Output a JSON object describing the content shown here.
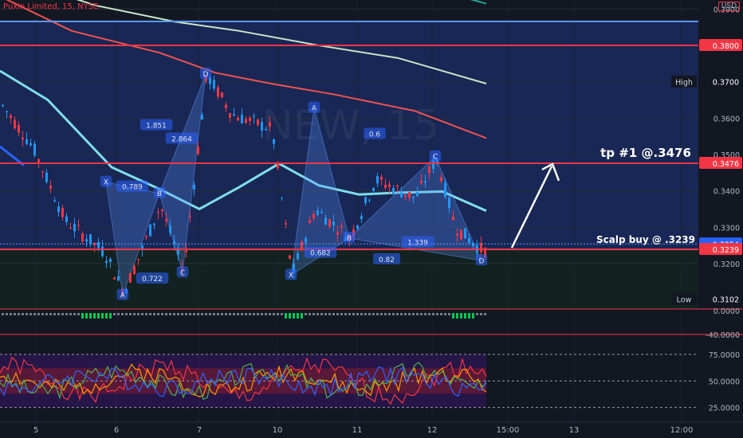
{
  "header": {
    "title": "Puxin Limited, 15, NYSE",
    "currency": "USD"
  },
  "chart_data": {
    "type": "candlestick",
    "x_ticks": [
      "5",
      "6",
      "7",
      "10",
      "11",
      "12",
      "15:00",
      "13",
      "12:00"
    ],
    "price_axis": {
      "ylim": [
        0.3075,
        0.3925
      ],
      "ticks": [
        "0.3900",
        "0.3800",
        "0.3700",
        "0.3600",
        "0.3500",
        "0.3400",
        "0.3300",
        "0.3200"
      ],
      "markers": [
        {
          "label": "0.3800",
          "value": 0.38,
          "color": "#f23645"
        },
        {
          "label": "0.3476",
          "value": 0.3476,
          "color": "#f23645"
        },
        {
          "label": "0.3254",
          "value": 0.3254,
          "color": "#2962ff"
        },
        {
          "label": "0.3239",
          "value": 0.3239,
          "color": "#f23645"
        },
        {
          "label": "0.3700",
          "value": 0.37,
          "color": "#131722",
          "tag": "High"
        },
        {
          "label": "0.3102",
          "value": 0.3102,
          "color": "#131722",
          "tag": "Low"
        }
      ]
    },
    "hlines": [
      {
        "value": 0.3866,
        "color": "#5b9cf6"
      },
      {
        "value": 0.38,
        "color": "#f23645"
      },
      {
        "value": 0.3476,
        "color": "#f23645"
      },
      {
        "value": 0.3239,
        "color": "#f23645"
      }
    ],
    "annotations": {
      "tp": "tp #1 @.3476",
      "scalp": "Scalp buy @ .3239",
      "symbol_watermark": "NEW, 15",
      "pattern_points": [
        {
          "t": "D",
          "x": 258,
          "v": 0.3721
        },
        {
          "t": "X",
          "x": 133,
          "v": 0.3424
        },
        {
          "t": "A",
          "x": 154,
          "v": 0.3113
        },
        {
          "t": "B",
          "x": 200,
          "v": 0.3393
        },
        {
          "t": "C",
          "x": 229,
          "v": 0.3175
        },
        {
          "t": "A",
          "x": 394,
          "v": 0.3628
        },
        {
          "t": "X",
          "x": 365,
          "v": 0.3168
        },
        {
          "t": "B",
          "x": 438,
          "v": 0.327
        },
        {
          "t": "C",
          "x": 546,
          "v": 0.3494
        },
        {
          "t": "D",
          "x": 604,
          "v": 0.3208
        }
      ],
      "ratios": [
        {
          "t": "1.851",
          "x": 196,
          "v": 0.358
        },
        {
          "t": "2.864",
          "x": 228,
          "v": 0.3543
        },
        {
          "t": "0.789",
          "x": 166,
          "v": 0.3411
        },
        {
          "t": "0.722",
          "x": 191,
          "v": 0.3158
        },
        {
          "t": "0.6",
          "x": 470,
          "v": 0.3556
        },
        {
          "t": "0.682",
          "x": 402,
          "v": 0.3229
        },
        {
          "t": "0.82",
          "x": 485,
          "v": 0.3211
        },
        {
          "t": "1.339",
          "x": 524,
          "v": 0.3258
        }
      ]
    },
    "mid_pane": {
      "ticks": [
        "0.0000",
        "-40.0000"
      ]
    },
    "rsi_pane": {
      "ticks": [
        "75.0000",
        "50.0000",
        "25.0000"
      ]
    },
    "colors": {
      "up": "#2196f3",
      "down": "#f23645",
      "bg": "#131722"
    }
  }
}
